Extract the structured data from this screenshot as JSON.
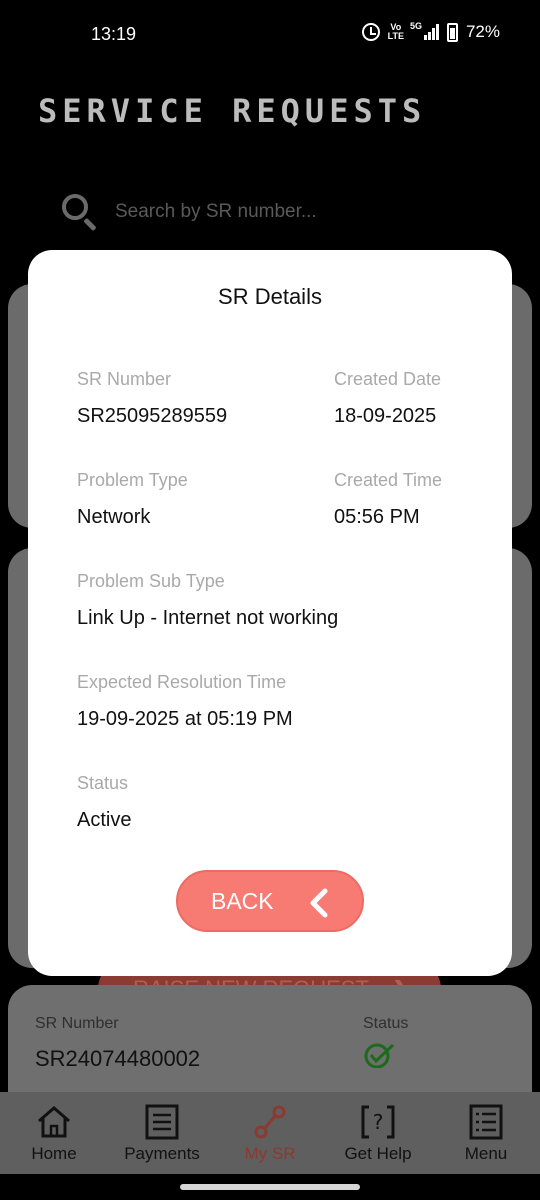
{
  "status_bar": {
    "time": "13:19",
    "volte_top": "Vo",
    "volte_bottom": "LTE",
    "network": "5G",
    "battery": "72%"
  },
  "header": {
    "title": "SERVICE REQUESTS"
  },
  "search": {
    "placeholder": "Search by SR number..."
  },
  "modal": {
    "title": "SR Details",
    "fields": {
      "sr_number": {
        "label": "SR Number",
        "value": "SR25095289559"
      },
      "created_date": {
        "label": "Created Date",
        "value": "18-09-2025"
      },
      "problem_type": {
        "label": "Problem Type",
        "value": "Network"
      },
      "created_time": {
        "label": "Created Time",
        "value": "05:56 PM"
      },
      "problem_sub_type": {
        "label": "Problem Sub Type",
        "value": "Link Up - Internet not working"
      },
      "expected_resolution": {
        "label": "Expected Resolution Time",
        "value": "19-09-2025 at 05:19 PM"
      },
      "status": {
        "label": "Status",
        "value": "Active"
      }
    },
    "back_label": "BACK"
  },
  "background": {
    "raise_label": "RAISE NEW REQUEST",
    "card": {
      "sr_label": "SR Number",
      "sr_value": "SR24074480002",
      "status_label": "Status"
    }
  },
  "nav": {
    "items": [
      {
        "label": "Home",
        "icon": "home-icon"
      },
      {
        "label": "Payments",
        "icon": "payments-icon"
      },
      {
        "label": "My SR",
        "icon": "wrench-icon"
      },
      {
        "label": "Get Help",
        "icon": "help-icon"
      },
      {
        "label": "Menu",
        "icon": "menu-icon"
      }
    ],
    "active_index": 2
  },
  "colors": {
    "accent": "#f77b72",
    "active_nav": "#8b3a2f",
    "nav_bg": "#5f5f5f",
    "card_bg": "#6b6b6b"
  }
}
